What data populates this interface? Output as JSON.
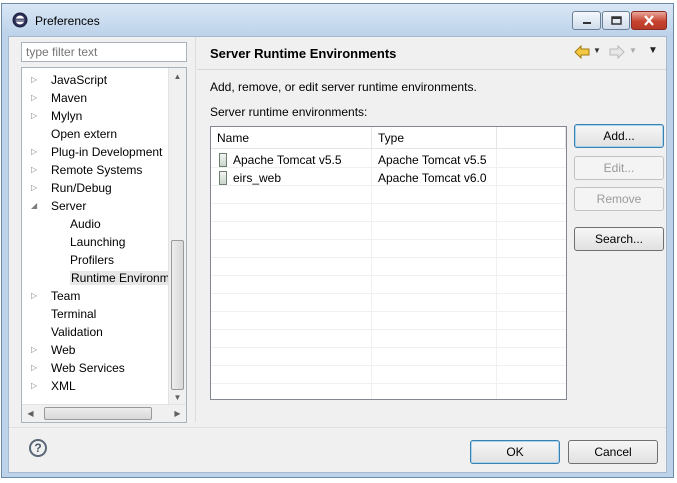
{
  "window": {
    "title": "Preferences"
  },
  "filter": {
    "placeholder": "type filter text"
  },
  "tree": {
    "items": [
      {
        "label": "JavaScript",
        "expandable": true
      },
      {
        "label": "Maven",
        "expandable": true
      },
      {
        "label": "Mylyn",
        "expandable": true
      },
      {
        "label": "Open extern",
        "expandable": false
      },
      {
        "label": "Plug-in Development",
        "expandable": true
      },
      {
        "label": "Remote Systems",
        "expandable": true
      },
      {
        "label": "Run/Debug",
        "expandable": true
      },
      {
        "label": "Server",
        "expandable": true,
        "expanded": true
      },
      {
        "label": "Audio",
        "child": true
      },
      {
        "label": "Launching",
        "child": true
      },
      {
        "label": "Profilers",
        "child": true
      },
      {
        "label": "Runtime Environme",
        "child": true,
        "selected": true
      },
      {
        "label": "Team",
        "expandable": true
      },
      {
        "label": "Terminal",
        "expandable": false
      },
      {
        "label": "Validation",
        "expandable": false
      },
      {
        "label": "Web",
        "expandable": true
      },
      {
        "label": "Web Services",
        "expandable": true
      },
      {
        "label": "XML",
        "expandable": true
      }
    ]
  },
  "page": {
    "title": "Server Runtime Environments",
    "description": "Add, remove, or edit server runtime environments.",
    "table_label": "Server runtime environments:"
  },
  "table": {
    "columns": [
      "Name",
      "Type"
    ],
    "rows": [
      {
        "name": "Apache Tomcat v5.5",
        "type": "Apache Tomcat v5.5"
      },
      {
        "name": "eirs_web",
        "type": "Apache Tomcat v6.0"
      }
    ]
  },
  "buttons": {
    "add": "Add...",
    "edit": "Edit...",
    "remove": "Remove",
    "search": "Search..."
  },
  "footer": {
    "ok": "OK",
    "cancel": "Cancel"
  },
  "colors": {
    "title_bg": "#bcd2ea",
    "close_button": "#c7432f",
    "default_button_border": "#3c7fb1"
  }
}
